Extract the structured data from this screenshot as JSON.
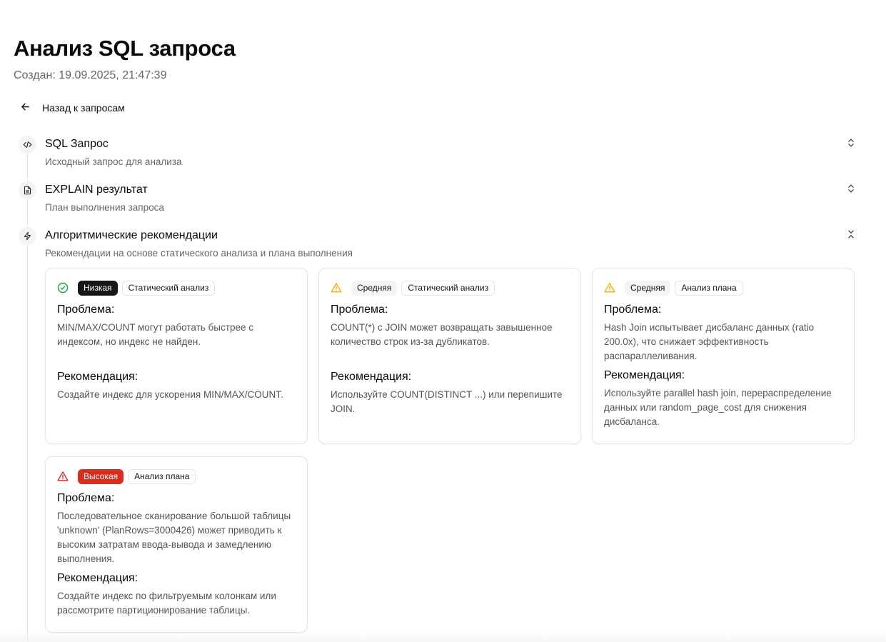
{
  "header": {
    "title": "Анализ SQL запроса",
    "created": "Создан: 19.09.2025, 21:47:39"
  },
  "nav": {
    "back_label": "Назад к запросам"
  },
  "sections": [
    {
      "title": "SQL Запрос",
      "subtitle": "Исходный запрос для анализа",
      "icon": "code-icon",
      "expanded": false
    },
    {
      "title": "EXPLAIN результат",
      "subtitle": "План выполнения запроса",
      "icon": "document-icon",
      "expanded": false
    },
    {
      "title": "Алгоритмические рекомендации",
      "subtitle": "Рекомендации на основе статического анализа и плана выполнения",
      "icon": "lightning-icon",
      "expanded": true
    }
  ],
  "labels": {
    "problem": "Проблема:",
    "recommendation": "Рекомендация:"
  },
  "recommendations": [
    {
      "severity": "Низкая",
      "severity_icon": "check-circle-icon",
      "source": "Статический анализ",
      "problem": "MIN/MAX/COUNT могут работать быстрее с индексом, но индекс не найден.",
      "recommendation": "Создайте индекс для ускорения MIN/MAX/COUNT."
    },
    {
      "severity": "Средняя",
      "severity_icon": "warning-icon",
      "source": "Статический анализ",
      "problem": "COUNT(*) с JOIN может возвращать завышенное количество строк из-за дубликатов.",
      "recommendation": "Используйте COUNT(DISTINCT ...) или перепишите JOIN."
    },
    {
      "severity": "Средняя",
      "severity_icon": "warning-icon",
      "source": "Анализ плана",
      "problem": "Hash Join испытывает дисбаланс данных (ratio 200.0x), что снижает эффективность распараллеливания.",
      "recommendation": "Используйте parallel hash join, перераспределение данных или random_page_cost для снижения дисбаланса."
    },
    {
      "severity": "Высокая",
      "severity_icon": "alert-triangle-icon",
      "source": "Анализ плана",
      "problem": "Последовательное сканирование большой таблицы 'unknown' (PlanRows=3000426) может приводить к высоким затратам ввода-вывода и замедлению выполнения.",
      "recommendation": "Создайте индекс по фильтруемым колонкам или рассмотрите партиционирование таблицы."
    }
  ],
  "colors": {
    "low_badge": "#171717",
    "high_badge": "#d92d20",
    "check_green": "#16a34a",
    "warning_amber": "#eab308",
    "alert_red": "#dc2626"
  }
}
